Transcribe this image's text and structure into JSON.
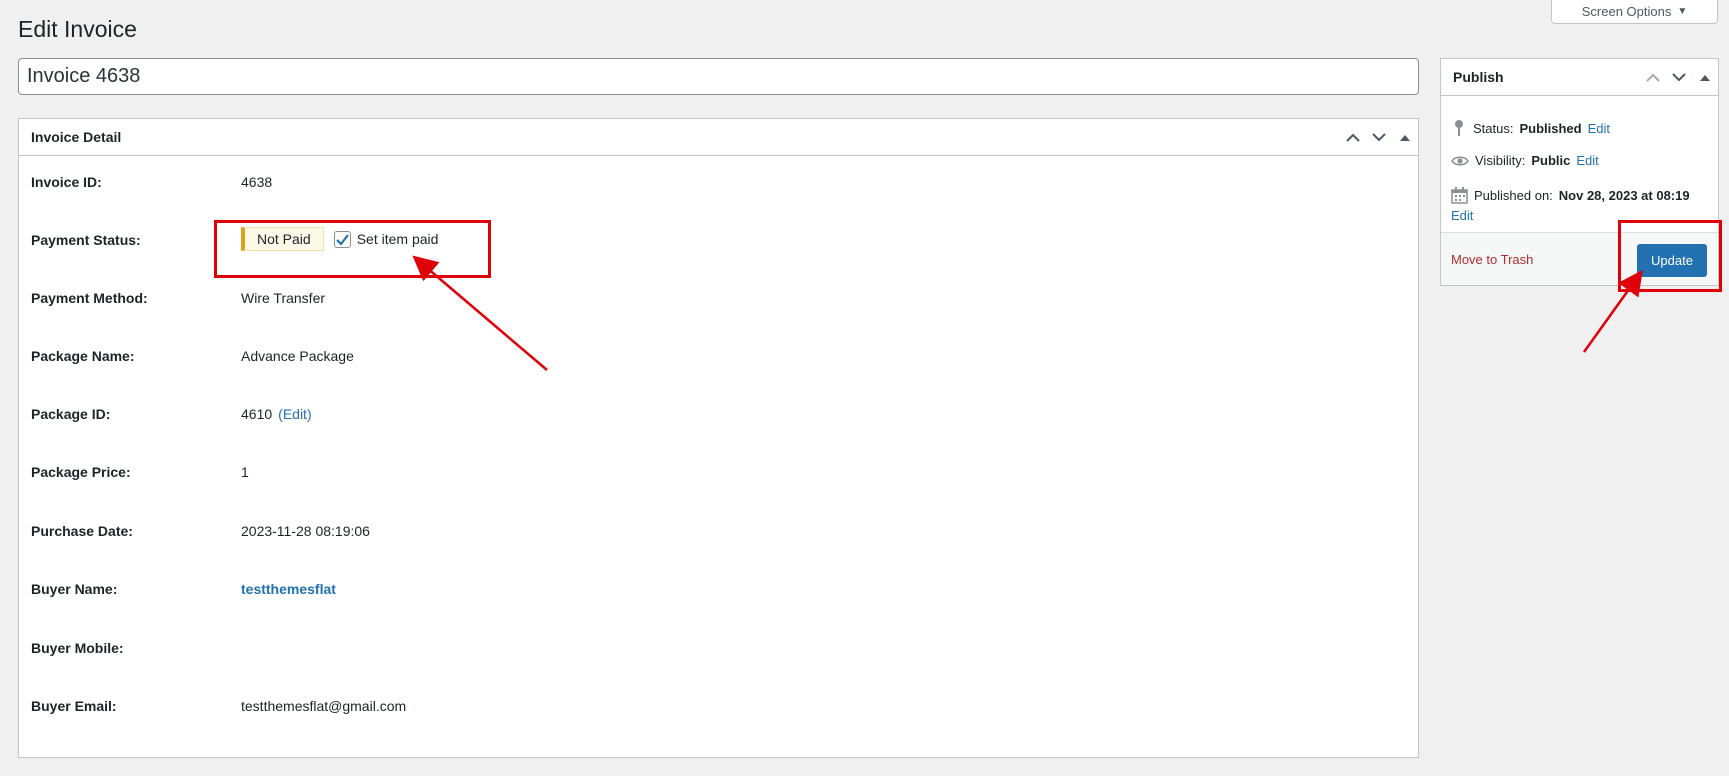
{
  "screen_options": {
    "label": "Screen Options",
    "icon": "caret-down-icon"
  },
  "page_title": "Edit Invoice",
  "post_title": "Invoice 4638",
  "invoice_detail": {
    "title": "Invoice Detail",
    "rows": {
      "invoice_id": {
        "label": "Invoice ID:",
        "value": "4638"
      },
      "payment_status": {
        "label": "Payment Status:",
        "badge": "Not Paid",
        "checkbox_label": "Set item paid",
        "checked": true
      },
      "payment_method": {
        "label": "Payment Method:",
        "value": "Wire Transfer"
      },
      "package_name": {
        "label": "Package Name:",
        "value": "Advance Package"
      },
      "package_id": {
        "label": "Package ID:",
        "value": "4610",
        "edit_link": "(Edit)"
      },
      "package_price": {
        "label": "Package Price:",
        "value": "1"
      },
      "purchase_date": {
        "label": "Purchase Date:",
        "value": "2023-11-28 08:19:06"
      },
      "buyer_name": {
        "label": "Buyer Name:",
        "value": "testthemesflat"
      },
      "buyer_mobile": {
        "label": "Buyer Mobile:",
        "value": ""
      },
      "buyer_email": {
        "label": "Buyer Email:",
        "value": "testthemesflat@gmail.com"
      }
    }
  },
  "publish": {
    "title": "Publish",
    "status_label": "Status:",
    "status_value": "Published",
    "status_edit": "Edit",
    "visibility_label": "Visibility:",
    "visibility_value": "Public",
    "visibility_edit": "Edit",
    "published_label": "Published on:",
    "published_value": "Nov 28, 2023 at 08:19",
    "published_edit": "Edit",
    "trash_label": "Move to Trash",
    "update_label": "Update"
  },
  "colors": {
    "accent": "#2271b1",
    "annotation": "#e0000a",
    "badge_border": "#dba617",
    "trash": "#b32d2e"
  }
}
